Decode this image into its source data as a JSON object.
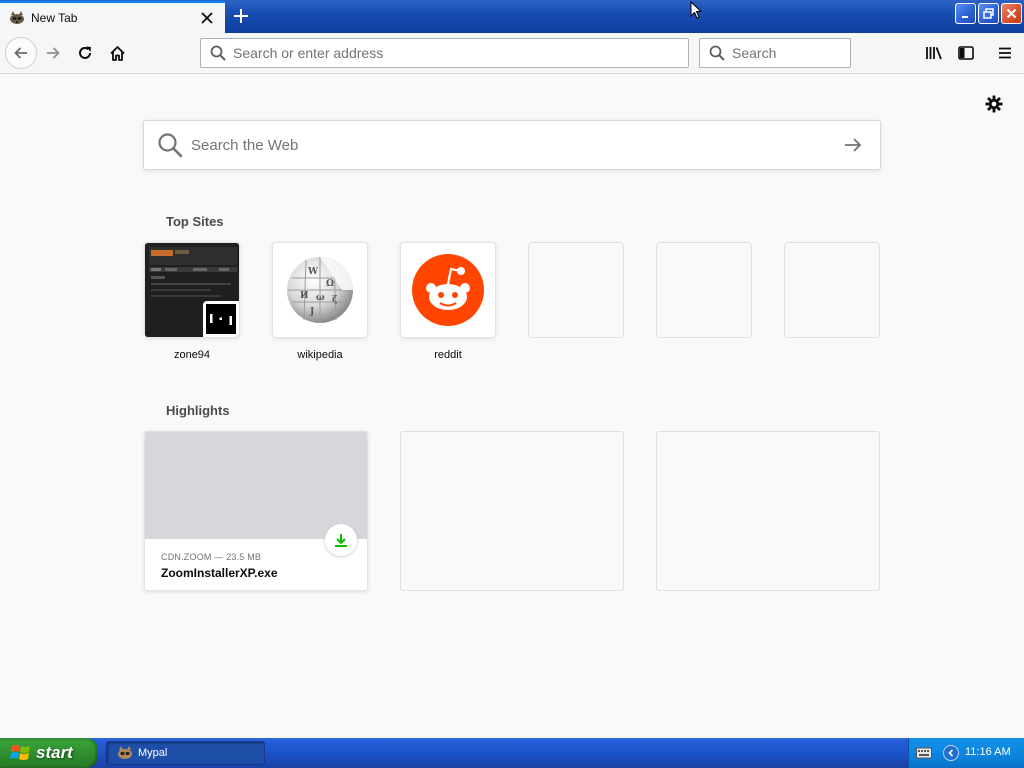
{
  "browser": {
    "tab": {
      "title": "New Tab",
      "favicon": "mypal-raccoon-icon"
    },
    "urlbar": {
      "placeholder": "Search or enter address"
    },
    "searchbar": {
      "placeholder": "Search"
    }
  },
  "newtab": {
    "search": {
      "placeholder": "Search the Web"
    },
    "top_sites_title": "Top Sites",
    "top_sites": [
      {
        "label": "zone94",
        "icon": "zone94-thumbnail"
      },
      {
        "label": "wikipedia",
        "icon": "wikipedia-globe-icon"
      },
      {
        "label": "reddit",
        "icon": "reddit-icon"
      },
      {
        "label": ""
      },
      {
        "label": ""
      },
      {
        "label": ""
      }
    ],
    "highlights_title": "Highlights",
    "highlights": [
      {
        "meta": "CDN.ZOOM — 23.5 MB",
        "title": "ZoomInstallerXP.exe",
        "badge": "download-icon"
      }
    ]
  },
  "taskbar": {
    "start_label": "start",
    "task": {
      "label": "Mypal"
    },
    "clock": "11:16 AM"
  },
  "colors": {
    "accent": "#0a84ff",
    "reddit": "#ff4500",
    "download_green": "#12bc00",
    "xp_blue": "#245edb",
    "xp_green": "#37a037"
  }
}
